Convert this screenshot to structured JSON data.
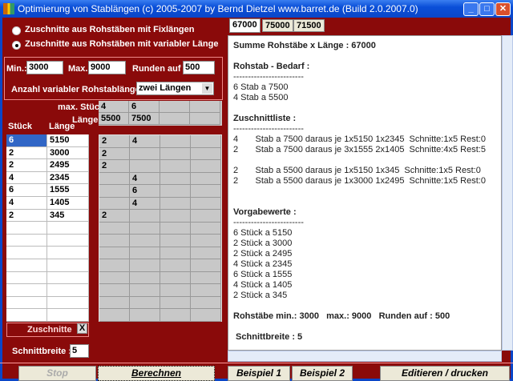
{
  "title": "Optimierung von Stablängen (c) 2005-2007  by Bernd Dietzel   www.barret.de   (Build 2.0.2007.0)",
  "radios": [
    {
      "label": "Zuschnitte aus Rohstäben mit Fixlängen",
      "checked": false
    },
    {
      "label": "Zuschnitte aus Rohstäben mit variabler Länge",
      "checked": true
    }
  ],
  "params": {
    "min_label": "Min.:",
    "min": "3000",
    "max_label": "Max.:",
    "max": "9000",
    "round_label": "Runden auf :",
    "round": "500",
    "count_label": "Anzahl variabler Rohstablängen :",
    "count_value": "zwei Längen"
  },
  "stock": {
    "maxcount_label": "max. Stück",
    "length_label": "Länge",
    "maxcount": [
      "4",
      "6",
      "",
      ""
    ],
    "lengths": [
      "5500",
      "7500",
      "",
      ""
    ]
  },
  "pieces": {
    "count_header": "Stück",
    "length_header": "Länge",
    "rows": [
      [
        "6",
        "5150"
      ],
      [
        "2",
        "3000"
      ],
      [
        "2",
        "2495"
      ],
      [
        "4",
        "2345"
      ],
      [
        "6",
        "1555"
      ],
      [
        "4",
        "1405"
      ],
      [
        "2",
        "345"
      ]
    ]
  },
  "cut_grid": [
    [
      "2",
      "4",
      "",
      ""
    ],
    [
      "2",
      "",
      "",
      ""
    ],
    [
      "2",
      "",
      "",
      ""
    ],
    [
      "",
      "4",
      "",
      ""
    ],
    [
      "",
      "6",
      "",
      ""
    ],
    [
      "",
      "4",
      "",
      ""
    ],
    [
      "2",
      "",
      "",
      ""
    ]
  ],
  "cuts_button": "Zuschnitte",
  "clear_button": "X",
  "kerf": {
    "label": "Schnittbreite :",
    "value": "5"
  },
  "buttons": {
    "stop": "Stop",
    "calc": "Berechnen",
    "example1": "Beispiel 1",
    "example2": "Beispiel 2",
    "edit": "Editieren / drucken"
  },
  "tabs": [
    "67000",
    "75000",
    "71500"
  ],
  "result_lines": [
    "Summe Rohstäbe x Länge : 67000",
    "",
    "Rohstab - Bedarf :",
    "------------------------",
    "6 Stab a 7500",
    "4 Stab a 5500",
    "",
    "Zuschnittliste :",
    "------------------------",
    "4       Stab a 7500 daraus je 1x5150 1x2345  Schnitte:1x5 Rest:0",
    "2       Stab a 7500 daraus je 3x1555 2x1405  Schnitte:4x5 Rest:5",
    "",
    "2       Stab a 5500 daraus je 1x5150 1x345  Schnitte:1x5 Rest:0",
    "2       Stab a 5500 daraus je 1x3000 1x2495  Schnitte:1x5 Rest:0",
    "",
    "",
    "Vorgabewerte :",
    "------------------------",
    "6 Stück a 5150",
    "2 Stück a 3000",
    "2 Stück a 2495",
    "4 Stück a 2345",
    "6 Stück a 1555",
    "4 Stück a 1405",
    "2 Stück a 345",
    "",
    "Rohstäbe min.: 3000   max.: 9000   Runden auf : 500",
    "",
    " Schnittbreite : 5"
  ]
}
